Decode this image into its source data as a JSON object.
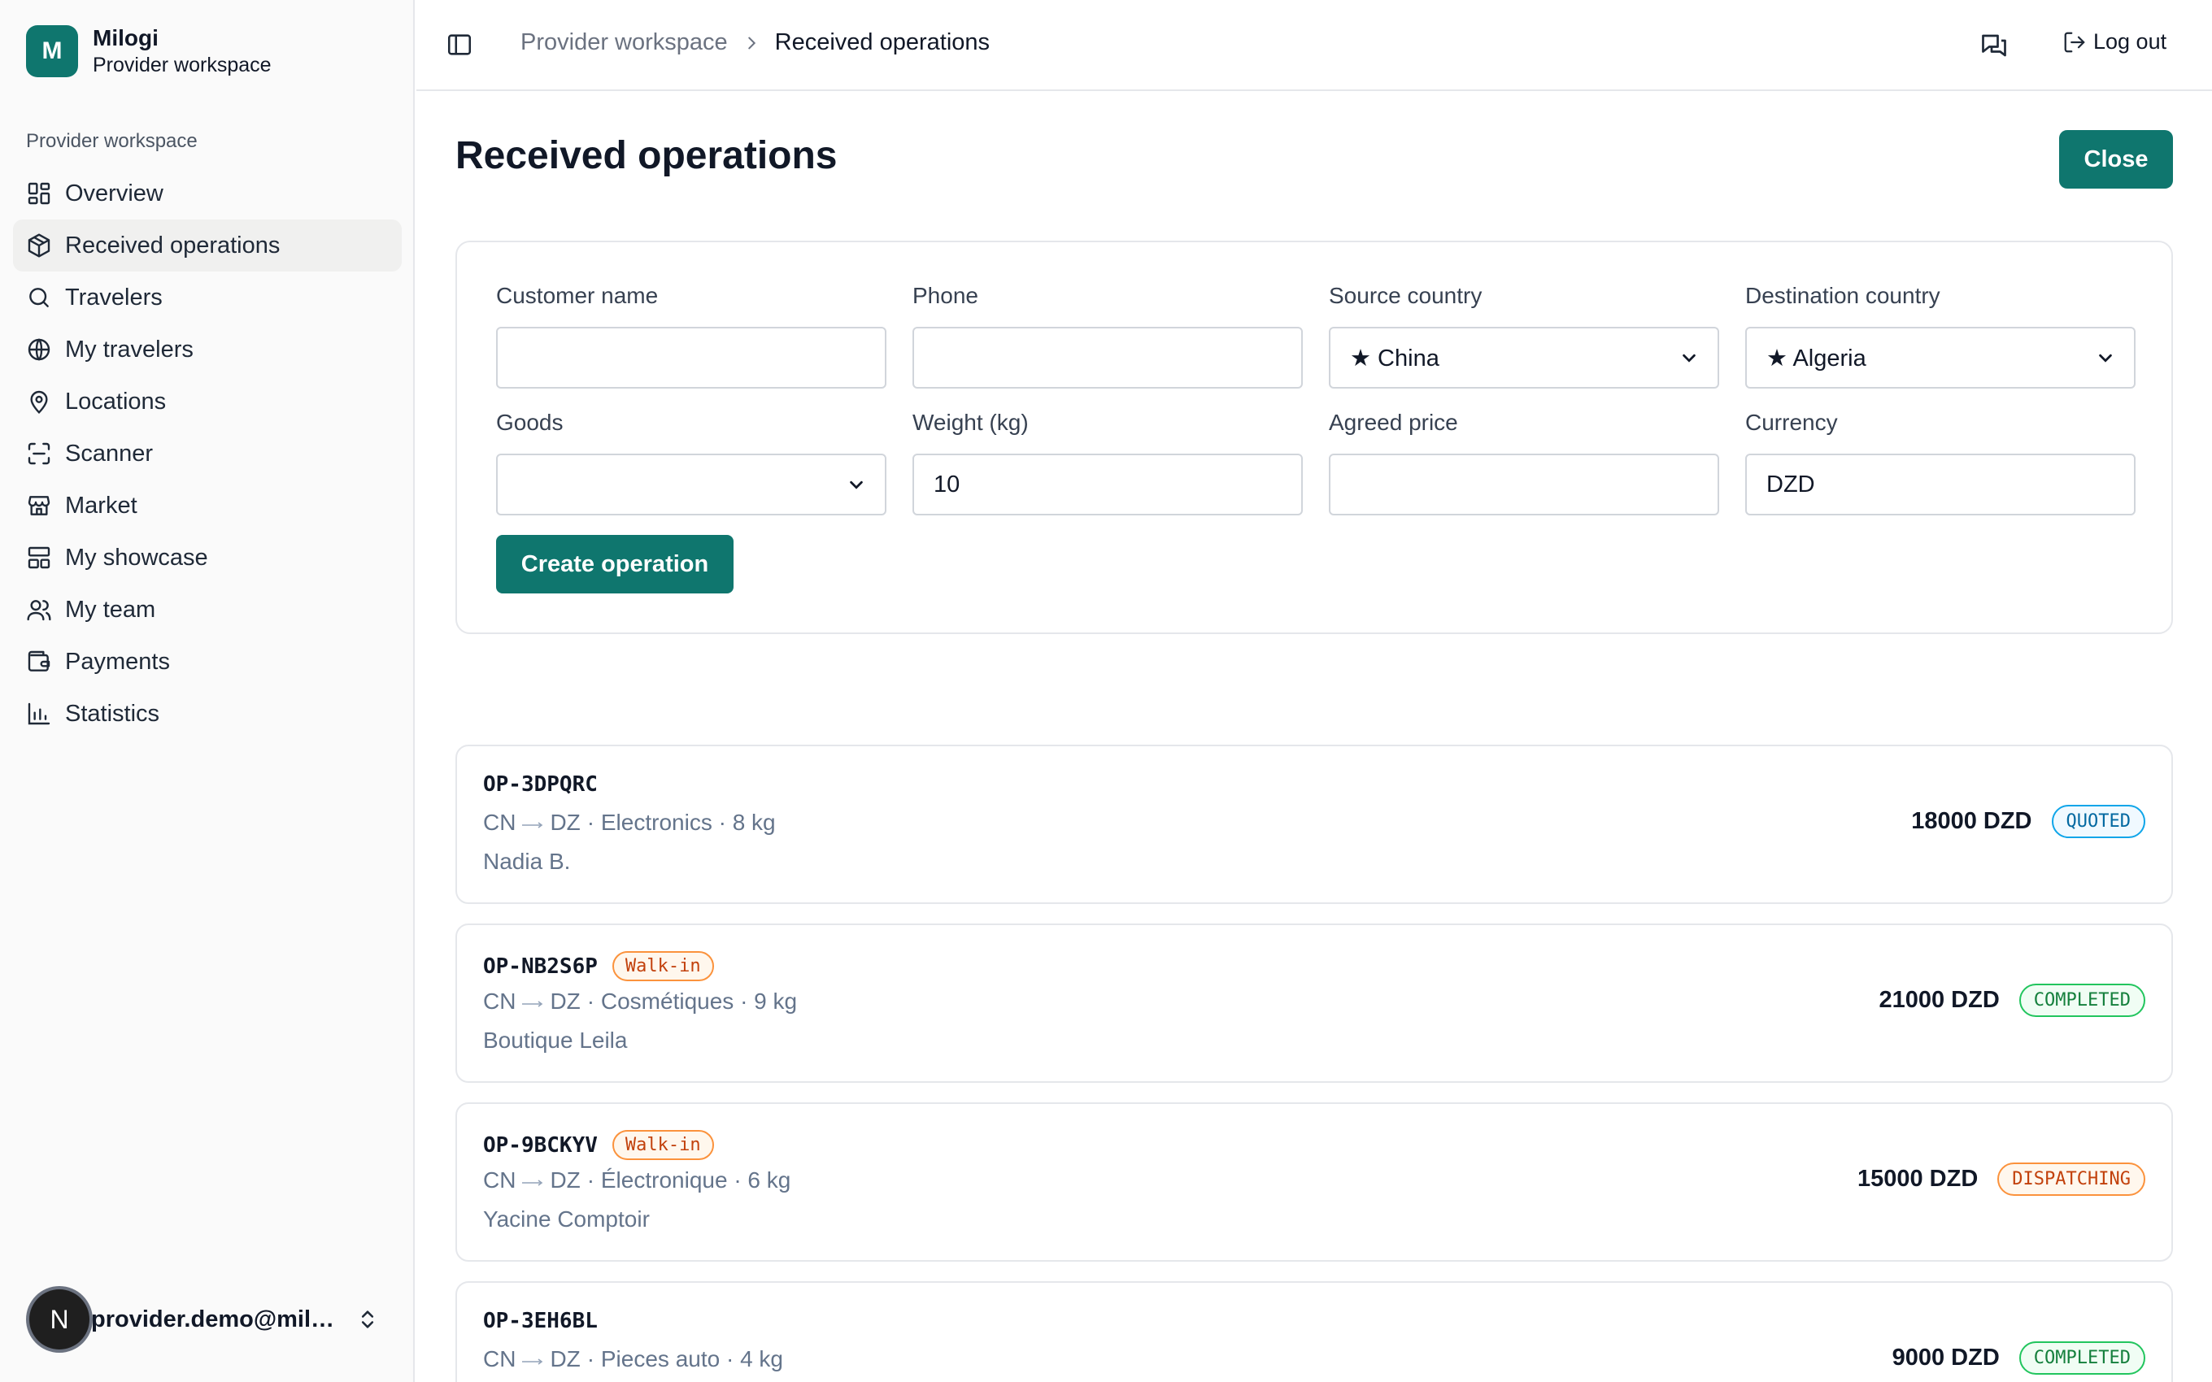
{
  "brand": {
    "logo_letter": "M",
    "name": "Milogi",
    "subtitle": "Provider workspace"
  },
  "sidebar": {
    "group_label": "Provider workspace",
    "items": [
      {
        "label": "Overview",
        "icon": "dashboard-icon"
      },
      {
        "label": "Received operations",
        "icon": "package-icon",
        "active": true
      },
      {
        "label": "Travelers",
        "icon": "search-icon"
      },
      {
        "label": "My travelers",
        "icon": "globe-icon"
      },
      {
        "label": "Locations",
        "icon": "map-pin-icon"
      },
      {
        "label": "Scanner",
        "icon": "scan-icon"
      },
      {
        "label": "Market",
        "icon": "store-icon"
      },
      {
        "label": "My showcase",
        "icon": "layout-icon"
      },
      {
        "label": "My team",
        "icon": "users-icon"
      },
      {
        "label": "Payments",
        "icon": "wallet-icon"
      },
      {
        "label": "Statistics",
        "icon": "bar-chart-icon"
      }
    ],
    "user": {
      "avatar_letter": "N",
      "email": "provider.demo@milogi.app"
    }
  },
  "topbar": {
    "breadcrumb_parent": "Provider workspace",
    "breadcrumb_current": "Received operations",
    "logout_label": "Log out"
  },
  "page": {
    "title": "Received operations",
    "close_label": "Close"
  },
  "form": {
    "customer_name": {
      "label": "Customer name",
      "value": ""
    },
    "phone": {
      "label": "Phone",
      "value": ""
    },
    "source_country": {
      "label": "Source country",
      "value": "★ China"
    },
    "destination_country": {
      "label": "Destination country",
      "value": "★ Algeria"
    },
    "goods": {
      "label": "Goods",
      "value": ""
    },
    "weight": {
      "label": "Weight (kg)",
      "value": "10"
    },
    "agreed_price": {
      "label": "Agreed price",
      "value": ""
    },
    "currency": {
      "label": "Currency",
      "value": "DZD"
    },
    "submit_label": "Create operation"
  },
  "operations": [
    {
      "id": "OP-3DPQRC",
      "walk_in": "",
      "from": "CN",
      "to": "DZ",
      "details": "· Electronics · 8 kg",
      "customer": "Nadia B.",
      "price": "18000 DZD",
      "status": "QUOTED"
    },
    {
      "id": "OP-NB2S6P",
      "walk_in": "Walk-in",
      "from": "CN",
      "to": "DZ",
      "details": "· Cosmétiques · 9 kg",
      "customer": "Boutique Leila",
      "price": "21000 DZD",
      "status": "COMPLETED"
    },
    {
      "id": "OP-9BCKYV",
      "walk_in": "Walk-in",
      "from": "CN",
      "to": "DZ",
      "details": "· Électronique · 6 kg",
      "customer": "Yacine Comptoir",
      "price": "15000 DZD",
      "status": "DISPATCHING"
    },
    {
      "id": "OP-3EH6BL",
      "walk_in": "",
      "from": "CN",
      "to": "DZ",
      "details": "· Pieces auto · 4 kg",
      "customer": "",
      "price": "9000 DZD",
      "status": "COMPLETED"
    }
  ],
  "colors": {
    "accent": "#0f766e",
    "quoted": "#0369a1",
    "completed": "#15803d",
    "dispatching": "#c2410c"
  }
}
